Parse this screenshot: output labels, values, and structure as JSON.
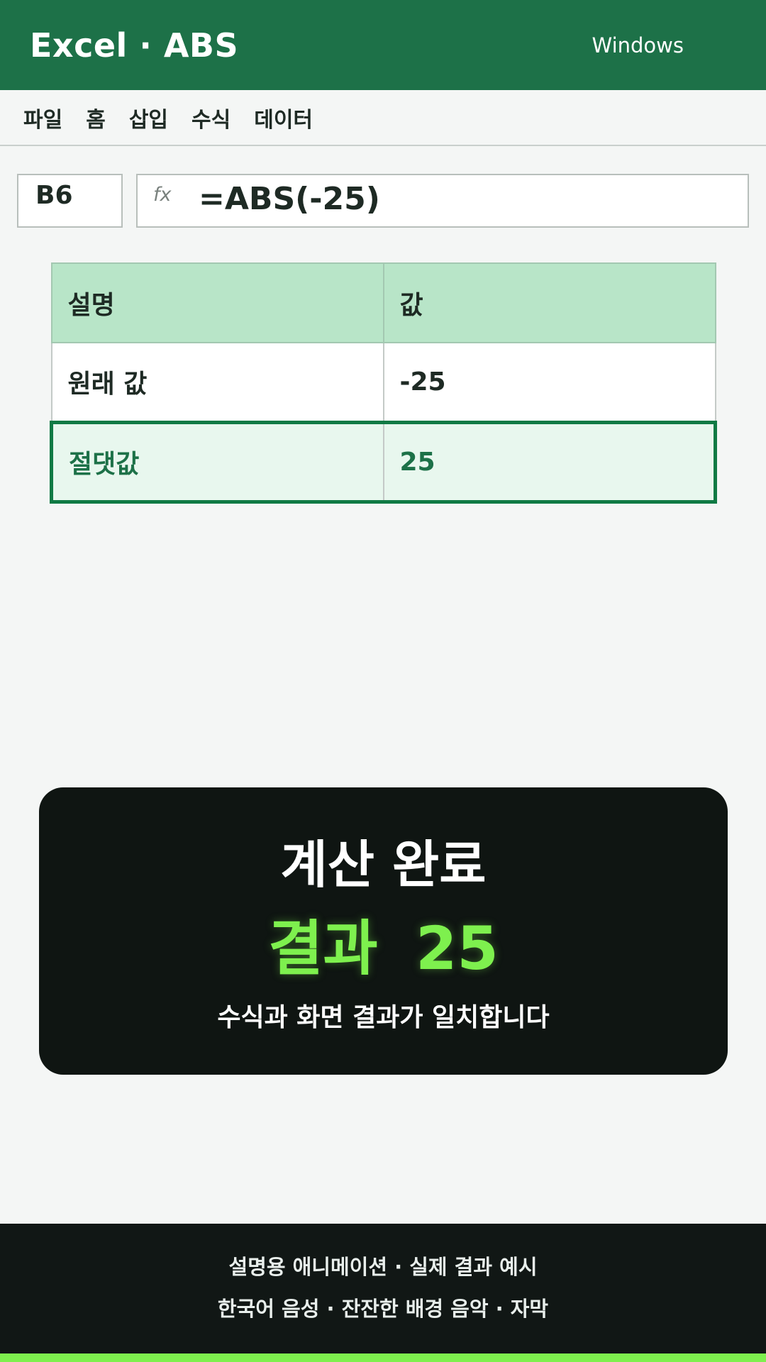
{
  "window": {
    "title": "Excel · ABS",
    "os_label": "Windows"
  },
  "ribbon": {
    "tabs": [
      "파일",
      "홈",
      "삽입",
      "수식",
      "데이터"
    ]
  },
  "formula_bar": {
    "name_box": "B6",
    "fx_label": "fx",
    "formula": "=ABS(-25)"
  },
  "sheet": {
    "headers": [
      "설명",
      "값"
    ],
    "rows": [
      [
        "원래 값",
        "-25"
      ],
      [
        "절댓값",
        "25"
      ]
    ]
  },
  "result_card": {
    "title": "계산 완료",
    "result_label": "결과",
    "result_value": "25",
    "note": "수식과 화면 결과가 일치합니다"
  },
  "footer": {
    "line1": "설명용 애니메이션 · 실제 결과 예시",
    "line2": "한국어 음성 · 잔잔한 배경 음악 · 자막"
  },
  "colors": {
    "brand_green": "#1d7148",
    "header_fill": "#b8e5c8",
    "highlight_border": "#0f7a44",
    "result_accent": "#7ef04e",
    "dark_panel": "#0f1512"
  }
}
